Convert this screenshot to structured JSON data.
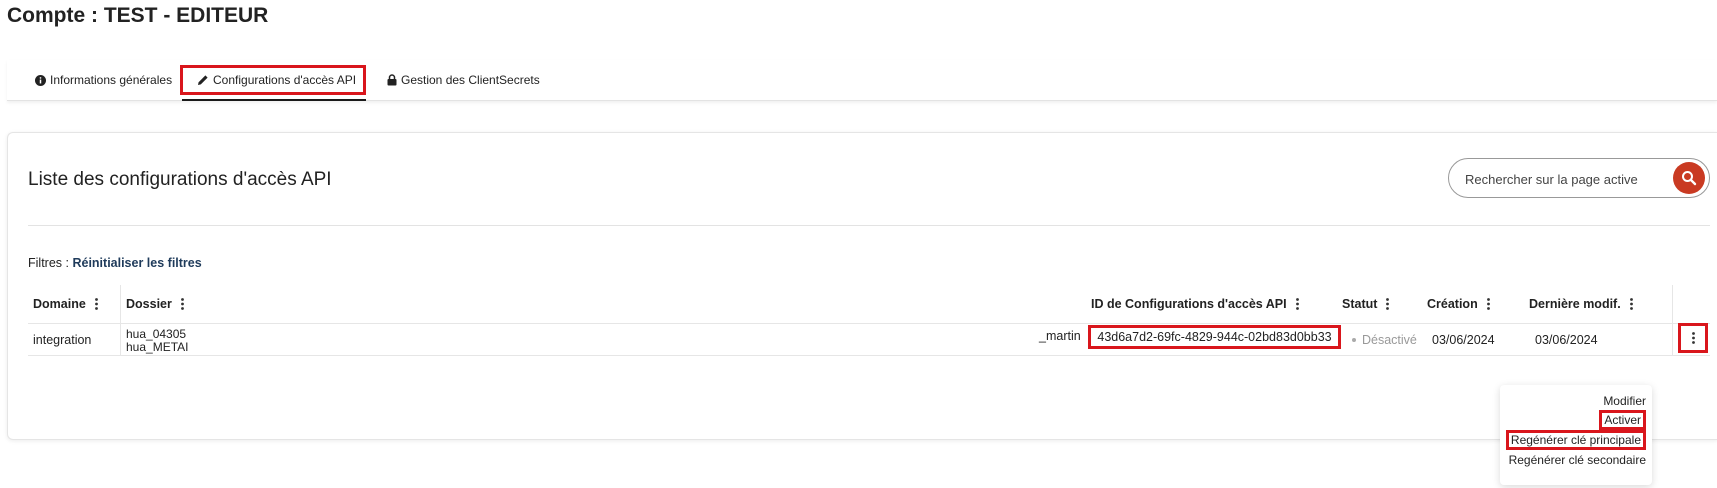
{
  "page": {
    "title": "Compte : TEST - EDITEUR"
  },
  "tabs": [
    {
      "label": "Informations générales",
      "icon": "info-circle-icon"
    },
    {
      "label": "Configurations d'accès API",
      "icon": "pencil-icon",
      "active": true
    },
    {
      "label": "Gestion des ClientSecrets",
      "icon": "lock-icon"
    }
  ],
  "list": {
    "title": "Liste des configurations d'accès API",
    "search": {
      "placeholder": "Rechercher sur la page active",
      "icon": "search-icon"
    },
    "filters": {
      "label": "Filtres :",
      "reset_label": "Réinitialiser les filtres"
    },
    "columns": [
      {
        "label": "Domaine"
      },
      {
        "label": "Dossier"
      },
      {
        "label": "ID de Configurations d'accès API"
      },
      {
        "label": "Statut"
      },
      {
        "label": "Création"
      },
      {
        "label": "Dernière modif."
      }
    ],
    "rows": [
      {
        "domaine": "integration",
        "dossier_line1": "hua_04305",
        "dossier_line2": "hua_METAI",
        "dossier_suffix": "_martin",
        "id": "43d6a7d2-69fc-4829-944c-02bd83d0bb33",
        "statut": "Désactivé",
        "creation": "03/06/2024",
        "derniere_modif": "03/06/2024"
      }
    ]
  },
  "row_menu": {
    "items": [
      {
        "label": "Modifier"
      },
      {
        "label": "Activer"
      },
      {
        "label": "Regénérer clé principale"
      },
      {
        "label": "Regénérer clé secondaire"
      }
    ]
  },
  "colors": {
    "highlight": "#d9161c",
    "search_button": "#c93a22",
    "link": "#1f3b5b"
  }
}
